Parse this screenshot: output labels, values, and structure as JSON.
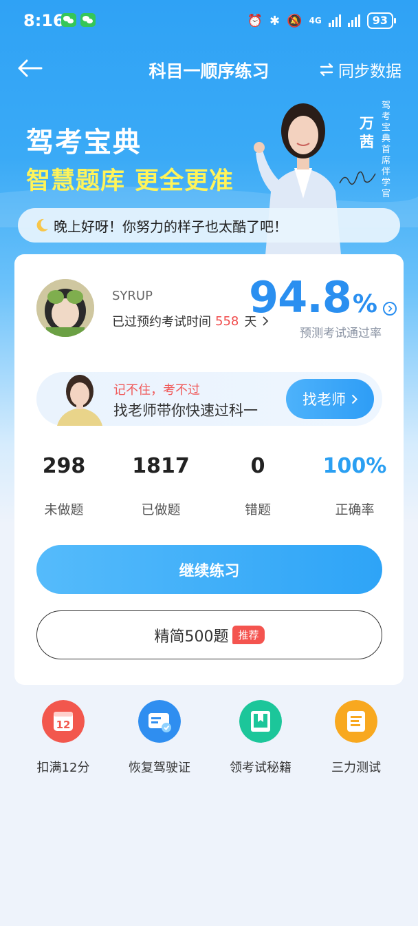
{
  "status_bar": {
    "time": "8:16",
    "network": "4G",
    "battery": "93"
  },
  "nav": {
    "title": "科目一顺序练习",
    "sync_label": "同步数据"
  },
  "banner": {
    "title": "驾考宝典",
    "subtitle_1": "智慧题库",
    "subtitle_2": "更全更准",
    "endorser_name": "万茜",
    "endorser_title": "驾考宝典首席伴学官"
  },
  "greeting": "晚上好呀！你努力的样子也太酷了吧！",
  "profile": {
    "username": "SYRUP",
    "exam_prefix": "已过预约考试时间",
    "exam_days": "558",
    "exam_unit": "天",
    "pass_rate": "94.8",
    "pass_rate_unit": "%",
    "pass_rate_label": "预测考试通过率"
  },
  "teacher": {
    "line1": "记不住，考不过",
    "line2": "找老师带你快速过科一",
    "button": "找老师"
  },
  "stats": [
    {
      "value": "298",
      "label": "未做题"
    },
    {
      "value": "1817",
      "label": "已做题"
    },
    {
      "value": "0",
      "label": "错题"
    },
    {
      "value": "100%",
      "label": "正确率"
    }
  ],
  "buttons": {
    "continue": "继续练习",
    "simplified": "精简500题",
    "simplified_badge": "推荐"
  },
  "tools": [
    {
      "label": "扣满12分",
      "icon": "calendar-12-icon",
      "color": "#f2574d",
      "glyph": "12"
    },
    {
      "label": "恢复驾驶证",
      "icon": "license-restore-icon",
      "color": "#2f8ef0"
    },
    {
      "label": "领考试秘籍",
      "icon": "book-icon",
      "color": "#1cc69a"
    },
    {
      "label": "三力测试",
      "icon": "document-icon",
      "color": "#f8a81f"
    }
  ],
  "colors": {
    "primary": "#2a8ff0",
    "accent_red": "#f04a4a",
    "highlight_yellow": "#fff45a"
  }
}
